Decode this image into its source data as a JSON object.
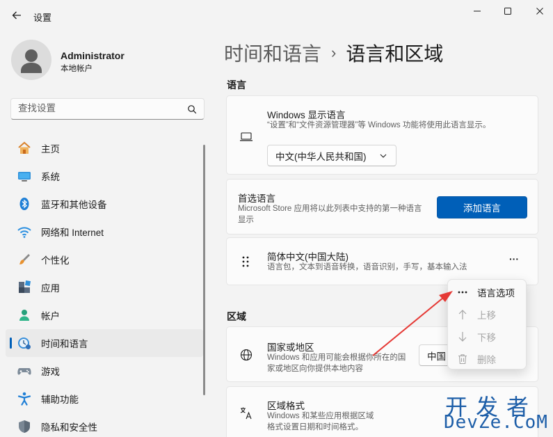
{
  "window": {
    "title": "设置"
  },
  "account": {
    "name": "Administrator",
    "type": "本地帐户"
  },
  "search": {
    "placeholder": "查找设置"
  },
  "nav": {
    "items": [
      {
        "label": "主页",
        "icon": "home-icon"
      },
      {
        "label": "系统",
        "icon": "monitor-icon"
      },
      {
        "label": "蓝牙和其他设备",
        "icon": "bluetooth-icon"
      },
      {
        "label": "网络和 Internet",
        "icon": "wifi-icon"
      },
      {
        "label": "个性化",
        "icon": "brush-icon"
      },
      {
        "label": "应用",
        "icon": "apps-icon"
      },
      {
        "label": "帐户",
        "icon": "person-icon"
      },
      {
        "label": "时间和语言",
        "icon": "clock-globe-icon",
        "selected": true
      },
      {
        "label": "游戏",
        "icon": "gamepad-icon"
      },
      {
        "label": "辅助功能",
        "icon": "accessibility-icon"
      },
      {
        "label": "隐私和安全性",
        "icon": "shield-icon"
      }
    ]
  },
  "breadcrumb": {
    "parent": "时间和语言",
    "separator": "›",
    "current": "语言和区域"
  },
  "language_section": {
    "title": "语言",
    "display_language": {
      "title": "Windows 显示语言",
      "description": "“设置”和“文件资源管理器”等 Windows 功能将使用此语言显示。",
      "selected": "中文(中华人民共和国)"
    },
    "preferred": {
      "title": "首选语言",
      "description": "Microsoft Store 应用将以此列表中支持的第一种语言显示",
      "button": "添加语言"
    },
    "language_item": {
      "name": "简体中文(中国大陆)",
      "features": "语言包，文本到语音转换，语音识别，手写，基本输入法",
      "more": "···"
    }
  },
  "region_section": {
    "title": "区域",
    "country": {
      "title": "国家或地区",
      "description": "Windows 和应用可能会根据你所在的国家或地区向你提供本地内容",
      "value": "中国"
    },
    "regional_format": {
      "title": "区域格式",
      "description": "Windows 和某些应用根据区域格式设置日期和时间格式。"
    }
  },
  "context_menu": {
    "items": [
      {
        "label": "语言选项",
        "icon": "more-icon",
        "enabled": true
      },
      {
        "label": "上移",
        "icon": "arrow-up-icon",
        "enabled": false
      },
      {
        "label": "下移",
        "icon": "arrow-down-icon",
        "enabled": false
      },
      {
        "label": "删除",
        "icon": "trash-icon",
        "enabled": false
      }
    ]
  },
  "watermark": {
    "line1": "开发者",
    "line2": "DevZe.CoM"
  },
  "colors": {
    "accent": "#005fb8",
    "arrow": "#e53935",
    "watermark": "#1d5ea8"
  }
}
